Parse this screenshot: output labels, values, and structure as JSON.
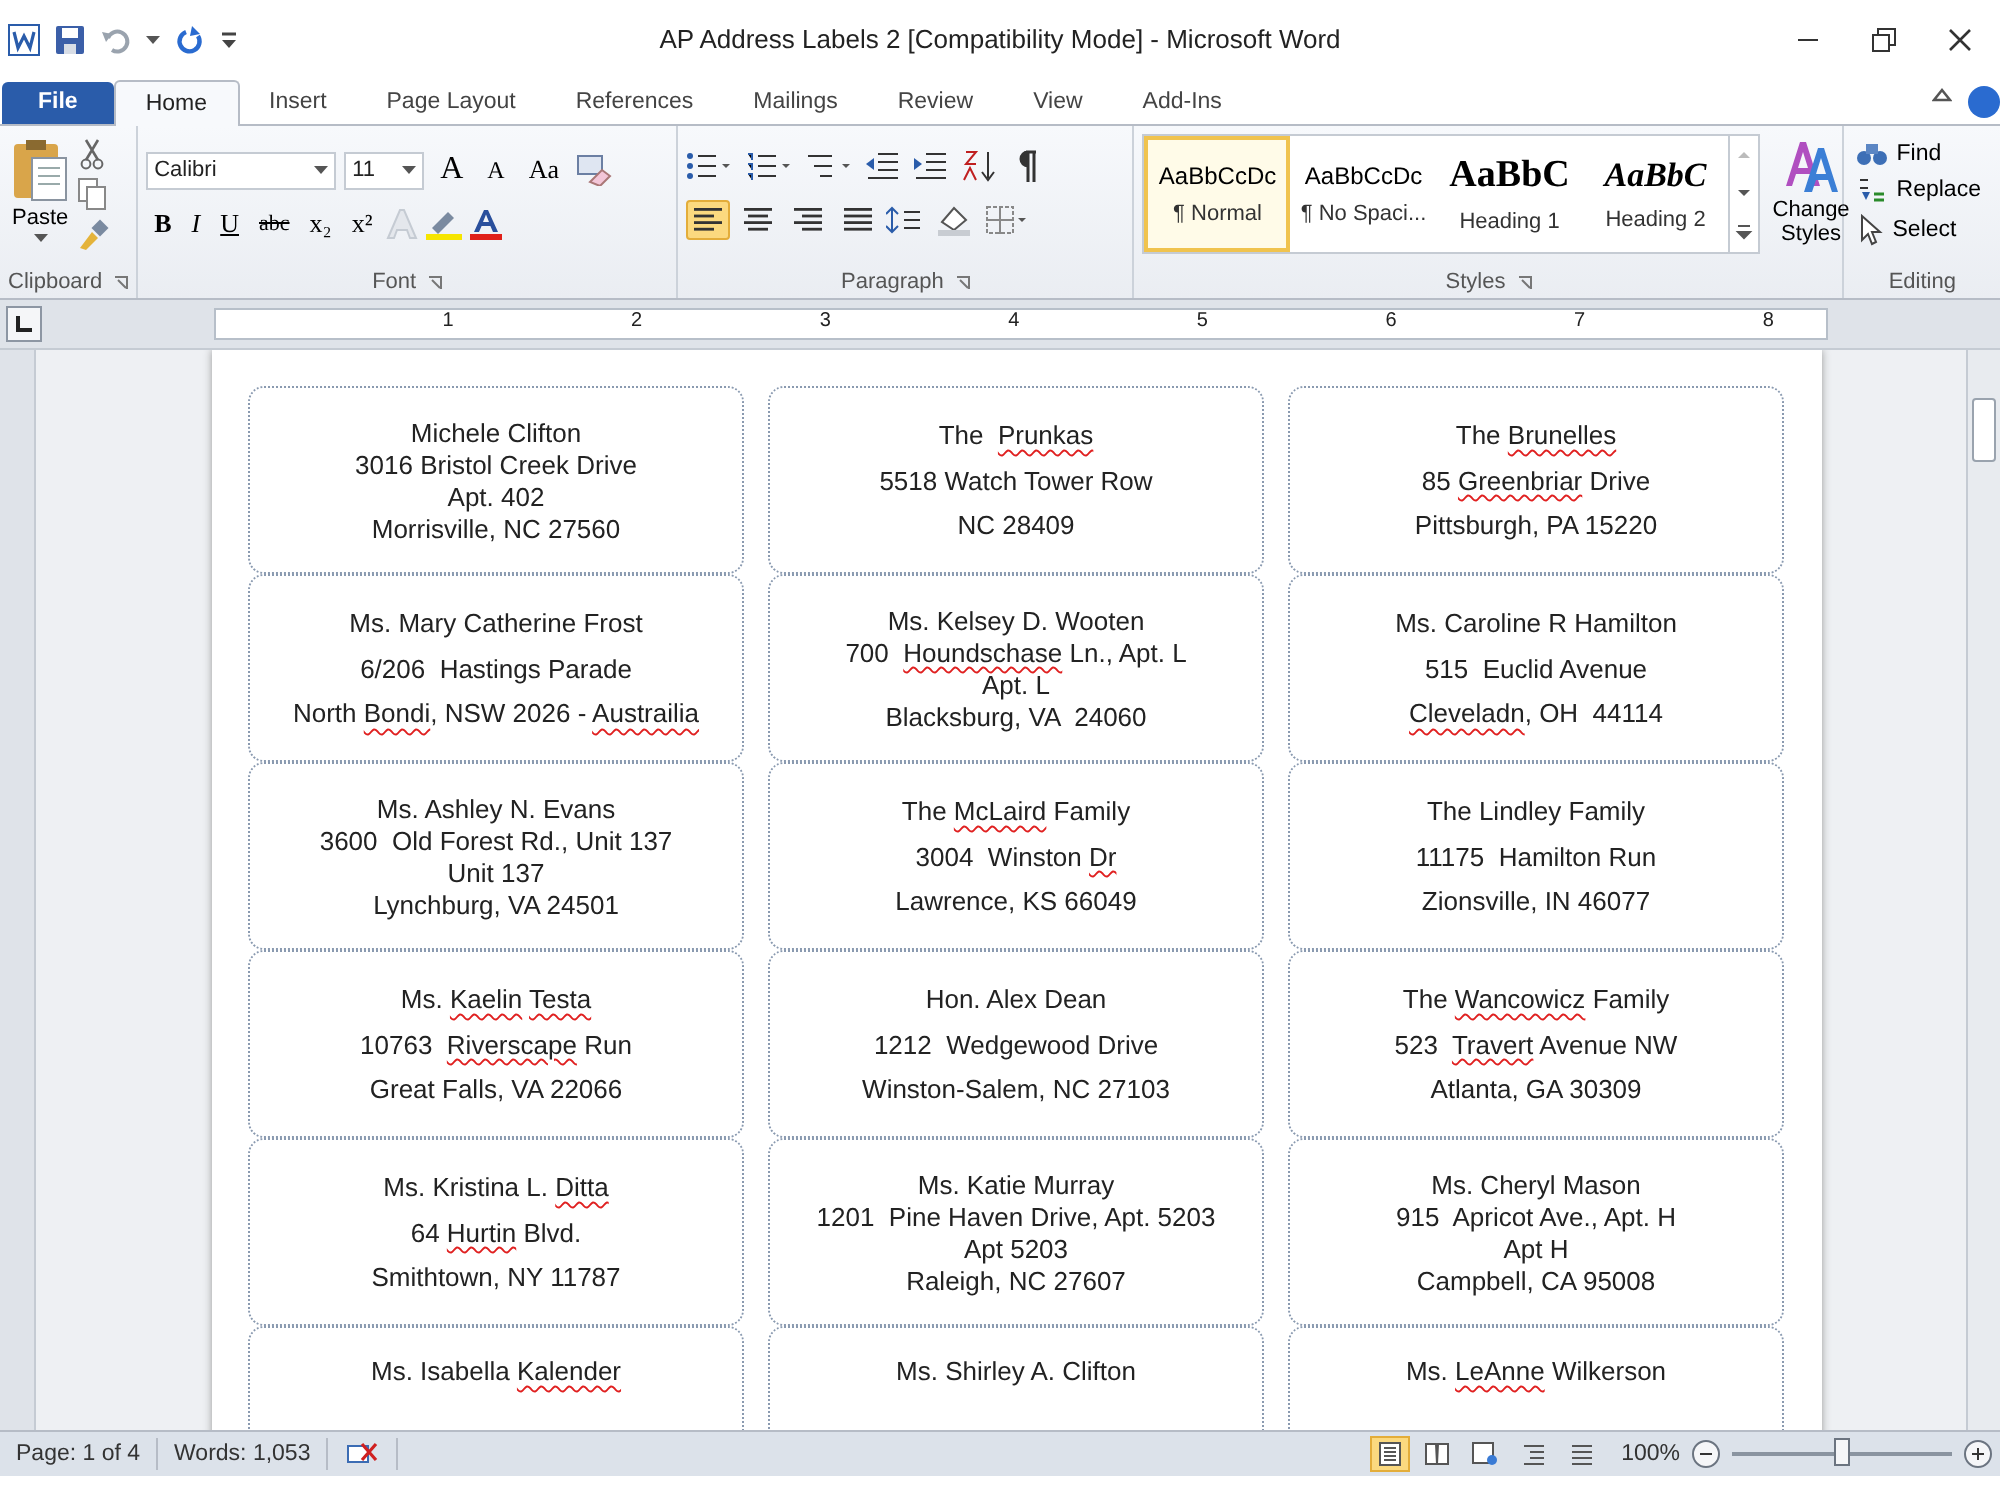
{
  "window": {
    "title": "AP Address Labels 2 [Compatibility Mode]  -  Microsoft Word"
  },
  "tabs": [
    {
      "label": "File",
      "kind": "file",
      "selected": false
    },
    {
      "label": "Home",
      "kind": "tab",
      "selected": true
    },
    {
      "label": "Insert",
      "kind": "tab",
      "selected": false
    },
    {
      "label": "Page Layout",
      "kind": "tab",
      "selected": false
    },
    {
      "label": "References",
      "kind": "tab",
      "selected": false
    },
    {
      "label": "Mailings",
      "kind": "tab",
      "selected": false
    },
    {
      "label": "Review",
      "kind": "tab",
      "selected": false
    },
    {
      "label": "View",
      "kind": "tab",
      "selected": false
    },
    {
      "label": "Add-Ins",
      "kind": "tab",
      "selected": false
    }
  ],
  "ribbon": {
    "clipboard": {
      "label": "Clipboard",
      "paste": "Paste"
    },
    "font": {
      "label": "Font",
      "family": "Calibri",
      "size": "11",
      "grow": "A",
      "shrink": "A",
      "change_case": "Aa",
      "format_buttons": [
        "B",
        "I",
        "U",
        "abc",
        "x₂",
        "x²"
      ]
    },
    "paragraph": {
      "label": "Paragraph",
      "alignments": [
        {
          "kind": "left",
          "selected": true
        },
        {
          "kind": "center",
          "selected": false
        },
        {
          "kind": "right",
          "selected": false
        },
        {
          "kind": "justify",
          "selected": false
        }
      ]
    },
    "styles": {
      "label": "Styles",
      "items": [
        {
          "preview": "AaBbCcDc",
          "name": "¶ Normal",
          "kind": "body",
          "selected": true
        },
        {
          "preview": "AaBbCcDc",
          "name": "¶ No Spaci...",
          "kind": "body",
          "selected": false
        },
        {
          "preview": "AaBbC",
          "name": "Heading 1",
          "kind": "heading1",
          "selected": false
        },
        {
          "preview": "AaBbC",
          "name": "Heading 2",
          "kind": "heading2",
          "selected": false
        }
      ],
      "change_styles": "Change Styles"
    },
    "editing": {
      "label": "Editing",
      "items": [
        {
          "label": "Find",
          "kind": "find"
        },
        {
          "label": "Replace",
          "kind": "replace"
        },
        {
          "label": "Select",
          "kind": "select"
        }
      ]
    }
  },
  "ruler": {
    "marks": [
      "1",
      "2",
      "3",
      "4",
      "5",
      "6",
      "7",
      "8"
    ]
  },
  "labels": [
    {
      "lines": [
        [
          {
            "text": "Michele Clifton",
            "spell_error": false
          }
        ],
        [
          {
            "text": "3016 Bristol Creek Drive",
            "spell_error": false
          }
        ],
        [
          {
            "text": "Apt. 402",
            "spell_error": false
          }
        ],
        [
          {
            "text": "Morrisville, NC 27560",
            "spell_error": false
          }
        ]
      ]
    },
    {
      "lines": [
        [
          {
            "text": "The  ",
            "spell_error": false
          },
          {
            "text": "Prunkas",
            "spell_error": true
          }
        ],
        [
          {
            "text": "5518 Watch Tower Row",
            "spell_error": false
          }
        ],
        [
          {
            "text": "NC 28409",
            "spell_error": false
          }
        ]
      ]
    },
    {
      "lines": [
        [
          {
            "text": "The ",
            "spell_error": false
          },
          {
            "text": "Brunelles",
            "spell_error": true
          }
        ],
        [
          {
            "text": "85 ",
            "spell_error": false
          },
          {
            "text": "Greenbriar",
            "spell_error": true
          },
          {
            "text": " Drive",
            "spell_error": false
          }
        ],
        [
          {
            "text": "Pittsburgh, PA 15220",
            "spell_error": false
          }
        ]
      ]
    },
    {
      "lines": [
        [
          {
            "text": "Ms. Mary Catherine Frost",
            "spell_error": false
          }
        ],
        [
          {
            "text": "6/206  Hastings Parade",
            "spell_error": false
          }
        ],
        [
          {
            "text": "North ",
            "spell_error": false
          },
          {
            "text": "Bondi",
            "spell_error": true
          },
          {
            "text": ", NSW 2026 - ",
            "spell_error": false
          },
          {
            "text": "Austrailia",
            "spell_error": true
          }
        ]
      ]
    },
    {
      "lines": [
        [
          {
            "text": "Ms. Kelsey D. Wooten",
            "spell_error": false
          }
        ],
        [
          {
            "text": "700  ",
            "spell_error": false
          },
          {
            "text": "Houndschase",
            "spell_error": true
          },
          {
            "text": " Ln., Apt. L",
            "spell_error": false
          }
        ],
        [
          {
            "text": "Apt. L",
            "spell_error": false
          }
        ],
        [
          {
            "text": "Blacksburg, VA  24060",
            "spell_error": false
          }
        ]
      ]
    },
    {
      "lines": [
        [
          {
            "text": "Ms. Caroline R Hamilton",
            "spell_error": false
          }
        ],
        [
          {
            "text": "515  Euclid Avenue",
            "spell_error": false
          }
        ],
        [
          {
            "text": "Cleveladn",
            "spell_error": true
          },
          {
            "text": ", OH  44114",
            "spell_error": false
          }
        ]
      ]
    },
    {
      "lines": [
        [
          {
            "text": "Ms. Ashley N. Evans",
            "spell_error": false
          }
        ],
        [
          {
            "text": "3600  Old Forest Rd., Unit 137",
            "spell_error": false
          }
        ],
        [
          {
            "text": "Unit 137",
            "spell_error": false
          }
        ],
        [
          {
            "text": "Lynchburg, VA 24501",
            "spell_error": false
          }
        ]
      ]
    },
    {
      "lines": [
        [
          {
            "text": "The ",
            "spell_error": false
          },
          {
            "text": "McLaird",
            "spell_error": true
          },
          {
            "text": " Family",
            "spell_error": false
          }
        ],
        [
          {
            "text": "3004  Winston ",
            "spell_error": false
          },
          {
            "text": "Dr",
            "spell_error": true
          }
        ],
        [
          {
            "text": "Lawrence, KS 66049",
            "spell_error": false
          }
        ]
      ]
    },
    {
      "lines": [
        [
          {
            "text": "The Lindley Family",
            "spell_error": false
          }
        ],
        [
          {
            "text": "11175  Hamilton Run",
            "spell_error": false
          }
        ],
        [
          {
            "text": "Zionsville, IN 46077",
            "spell_error": false
          }
        ]
      ]
    },
    {
      "lines": [
        [
          {
            "text": "Ms. ",
            "spell_error": false
          },
          {
            "text": "Kaelin",
            "spell_error": true
          },
          {
            "text": " Testa",
            "spell_error": true
          }
        ],
        [
          {
            "text": "10763  ",
            "spell_error": false
          },
          {
            "text": "Riverscape",
            "spell_error": true
          },
          {
            "text": " Run",
            "spell_error": false
          }
        ],
        [
          {
            "text": "Great Falls, VA 22066",
            "spell_error": false
          }
        ]
      ]
    },
    {
      "lines": [
        [
          {
            "text": "Hon. Alex Dean",
            "spell_error": false
          }
        ],
        [
          {
            "text": "1212  Wedgewood Drive",
            "spell_error": false
          }
        ],
        [
          {
            "text": "Winston-Salem, NC 27103",
            "spell_error": false
          }
        ]
      ]
    },
    {
      "lines": [
        [
          {
            "text": "The ",
            "spell_error": false
          },
          {
            "text": "Wancowicz",
            "spell_error": true
          },
          {
            "text": " Family",
            "spell_error": false
          }
        ],
        [
          {
            "text": "523  ",
            "spell_error": false
          },
          {
            "text": "Travert",
            "spell_error": true
          },
          {
            "text": " Avenue NW",
            "spell_error": false
          }
        ],
        [
          {
            "text": "Atlanta, GA 30309",
            "spell_error": false
          }
        ]
      ]
    },
    {
      "lines": [
        [
          {
            "text": "Ms. Kristina L. ",
            "spell_error": false
          },
          {
            "text": "Ditta",
            "spell_error": true
          }
        ],
        [
          {
            "text": "64 ",
            "spell_error": false
          },
          {
            "text": "Hurtin",
            "spell_error": true
          },
          {
            "text": " Blvd.",
            "spell_error": false
          }
        ],
        [
          {
            "text": "Smithtown, NY 11787",
            "spell_error": false
          }
        ]
      ]
    },
    {
      "lines": [
        [
          {
            "text": "Ms. Katie Murray",
            "spell_error": false
          }
        ],
        [
          {
            "text": "1201  Pine Haven Drive, Apt. 5203",
            "spell_error": false
          }
        ],
        [
          {
            "text": "Apt 5203",
            "spell_error": false
          }
        ],
        [
          {
            "text": "Raleigh, NC 27607",
            "spell_error": false
          }
        ]
      ]
    },
    {
      "lines": [
        [
          {
            "text": "Ms. Cheryl Mason",
            "spell_error": false
          }
        ],
        [
          {
            "text": "915  Apricot Ave., Apt. H",
            "spell_error": false
          }
        ],
        [
          {
            "text": "Apt H",
            "spell_error": false
          }
        ],
        [
          {
            "text": "Campbell, CA 95008",
            "spell_error": false
          }
        ]
      ]
    },
    {
      "lines": [
        [
          {
            "text": "Ms. Isabella ",
            "spell_error": false
          },
          {
            "text": "Kalender",
            "spell_error": true
          }
        ]
      ]
    },
    {
      "lines": [
        [
          {
            "text": "Ms. Shirley A. Clifton",
            "spell_error": false
          }
        ]
      ]
    },
    {
      "lines": [
        [
          {
            "text": "Ms. ",
            "spell_error": false
          },
          {
            "text": "LeAnne",
            "spell_error": true
          },
          {
            "text": " Wilkerson",
            "spell_error": false
          }
        ]
      ]
    }
  ],
  "status_bar": {
    "page": "Page: 1 of 4",
    "words": "Words: 1,053",
    "views": [
      {
        "kind": "print",
        "selected": true
      },
      {
        "kind": "reading",
        "selected": false
      },
      {
        "kind": "web",
        "selected": false
      },
      {
        "kind": "outline",
        "selected": false
      },
      {
        "kind": "draft",
        "selected": false
      }
    ],
    "zoom": {
      "label": "100%",
      "level": 0.5
    }
  }
}
